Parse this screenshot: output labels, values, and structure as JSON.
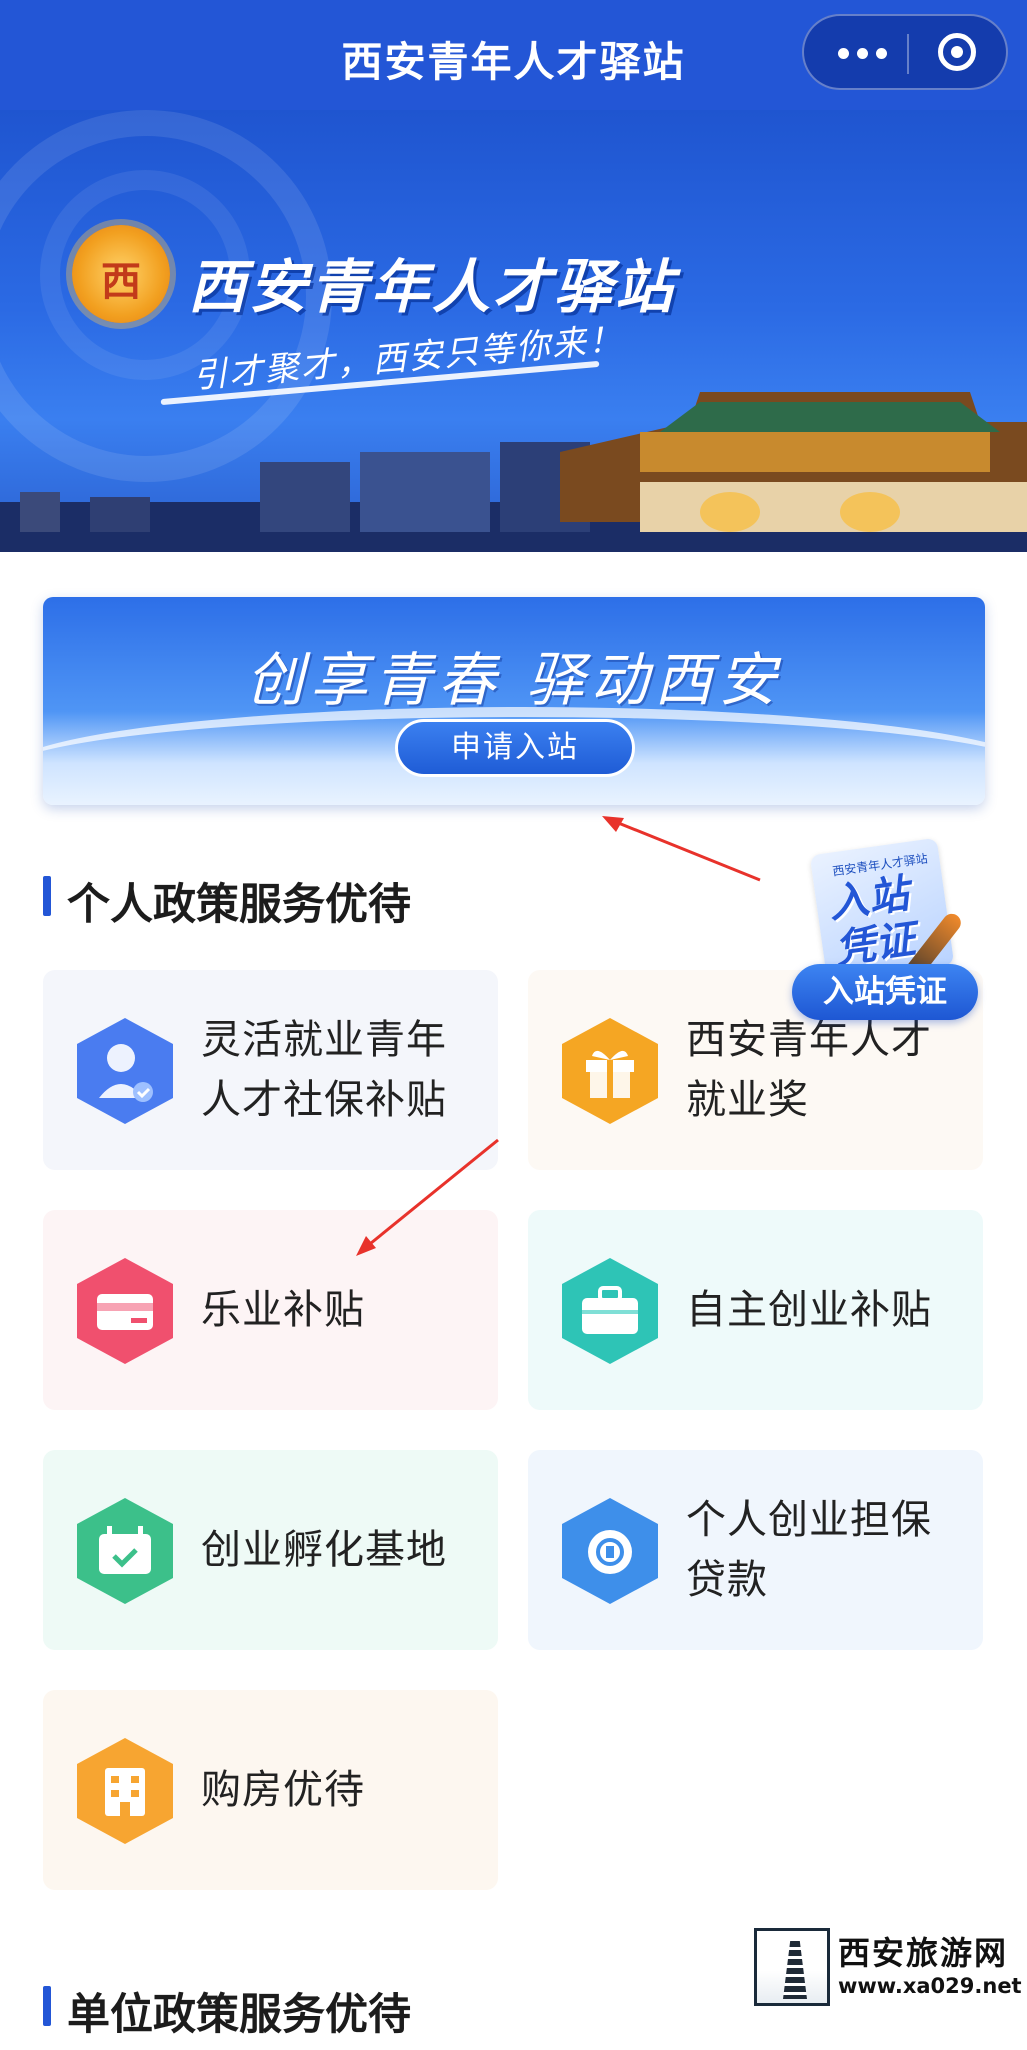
{
  "nav": {
    "title": "西安青年人才驿站",
    "more_icon": "more-dots-icon",
    "close_icon": "target-circle-icon"
  },
  "hero": {
    "logo_char": "西",
    "title": "西安青年人才驿站",
    "slogan": "引才聚才，西安只等你来！"
  },
  "apply_banner": {
    "title": "创享青春 驿动西安",
    "button": "申请入站"
  },
  "badge": {
    "small_text": "西安青年人才驿站",
    "big_line1": "入站",
    "big_line2": "凭证",
    "button": "入站凭证"
  },
  "section_personal": {
    "title": "个人政策服务优待"
  },
  "personal_items": [
    {
      "label_line1": "灵活就业青年",
      "label_line2": "人才社保补贴",
      "icon": "person-check-icon"
    },
    {
      "label_line1": "西安青年人才",
      "label_line2": "就业奖",
      "icon": "gift-icon"
    },
    {
      "label_line1": "乐业补贴",
      "label_line2": "",
      "icon": "card-icon"
    },
    {
      "label_line1": "自主创业补贴",
      "label_line2": "",
      "icon": "briefcase-icon"
    },
    {
      "label_line1": "创业孵化基地",
      "label_line2": "",
      "icon": "calendar-check-icon"
    },
    {
      "label_line1": "个人创业担保",
      "label_line2": "贷款",
      "icon": "coin-icon"
    },
    {
      "label_line1": "购房优待",
      "label_line2": "",
      "icon": "building-icon"
    }
  ],
  "section_unit": {
    "title": "单位政策服务优待"
  },
  "watermark": {
    "title": "西安旅游网",
    "url": "www.xa029.net"
  },
  "colors": {
    "primary": "#2356d6",
    "blue_icon": "#4a7cf0",
    "orange_icon": "#f5a623",
    "red_icon": "#f0506e",
    "teal_icon": "#2ec4b6",
    "green_icon": "#3cc08a"
  }
}
